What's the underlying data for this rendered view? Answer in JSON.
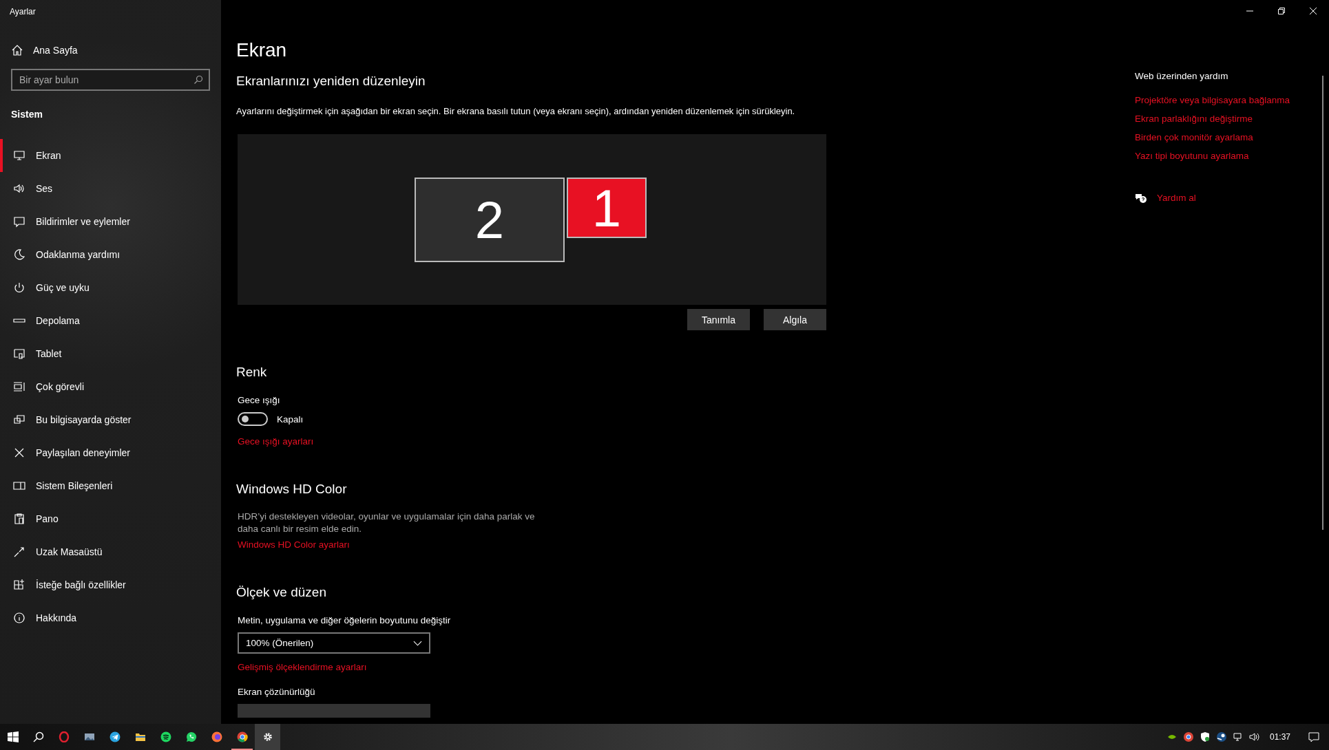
{
  "window": {
    "title": "Ayarlar"
  },
  "sidebar": {
    "home": "Ana Sayfa",
    "search": {
      "placeholder": "Bir ayar bulun"
    },
    "section": "Sistem",
    "items": [
      {
        "label": "Ekran",
        "selected": true
      },
      {
        "label": "Ses",
        "selected": false
      },
      {
        "label": "Bildirimler ve eylemler",
        "selected": false
      },
      {
        "label": "Odaklanma yardımı",
        "selected": false
      },
      {
        "label": "Güç ve uyku",
        "selected": false
      },
      {
        "label": "Depolama",
        "selected": false
      },
      {
        "label": "Tablet",
        "selected": false
      },
      {
        "label": "Çok görevli",
        "selected": false
      },
      {
        "label": "Bu bilgisayarda göster",
        "selected": false
      },
      {
        "label": "Paylaşılan deneyimler",
        "selected": false
      },
      {
        "label": "Sistem Bileşenleri",
        "selected": false
      },
      {
        "label": "Pano",
        "selected": false
      },
      {
        "label": "Uzak Masaüstü",
        "selected": false
      },
      {
        "label": "İsteğe bağlı özellikler",
        "selected": false
      },
      {
        "label": "Hakkında",
        "selected": false
      }
    ]
  },
  "main": {
    "title": "Ekran",
    "arrange": {
      "heading": "Ekranlarınızı yeniden düzenleyin",
      "description": "Ayarlarını değiştirmek için aşağıdan bir ekran seçin. Bir ekrana basılı tutun (veya ekranı seçin), ardından yeniden düzenlemek için sürükleyin.",
      "displays": [
        {
          "number": "2",
          "selected": false
        },
        {
          "number": "1",
          "selected": true
        }
      ],
      "buttons": [
        "Tanımla",
        "Algıla"
      ]
    },
    "color": {
      "heading": "Renk",
      "night_light": {
        "label": "Gece ışığı",
        "on": false,
        "state": "Kapalı"
      },
      "link": "Gece ışığı ayarları"
    },
    "hdr": {
      "heading": "Windows HD Color",
      "description": "HDR’yi destekleyen videolar, oyunlar ve uygulamalar için daha parlak ve daha canlı bir resim elde edin.",
      "link": "Windows HD Color ayarları"
    },
    "scale": {
      "heading": "Ölçek ve düzen",
      "size_label": "Metin, uygulama ve diğer öğelerin boyutunu değiştir",
      "size_value": "100% (Önerilen)",
      "link": "Gelişmiş ölçeklendirme ayarları",
      "resolution_label": "Ekran çözünürlüğü"
    }
  },
  "help": {
    "heading": "Web üzerinden yardım",
    "links": [
      "Projektöre veya bilgisayara bağlanma",
      "Ekran parlaklığını değiştirme",
      "Birden çok monitör ayarlama",
      "Yazı tipi boyutunu ayarlama"
    ],
    "get_help": "Yardım al"
  },
  "taskbar": {
    "apps": [
      {
        "kind": "start",
        "selected": false
      },
      {
        "kind": "search",
        "selected": false
      },
      {
        "kind": "opera",
        "selected": false
      },
      {
        "kind": "photos",
        "selected": false
      },
      {
        "kind": "telegram",
        "selected": false
      },
      {
        "kind": "folder",
        "selected": false
      },
      {
        "kind": "spotify",
        "selected": false
      },
      {
        "kind": "whatsapp",
        "selected": false
      },
      {
        "kind": "firefox",
        "selected": false
      },
      {
        "kind": "chrome",
        "selected": false
      },
      {
        "kind": "settings",
        "selected": true
      }
    ],
    "clock": "01:37"
  }
}
